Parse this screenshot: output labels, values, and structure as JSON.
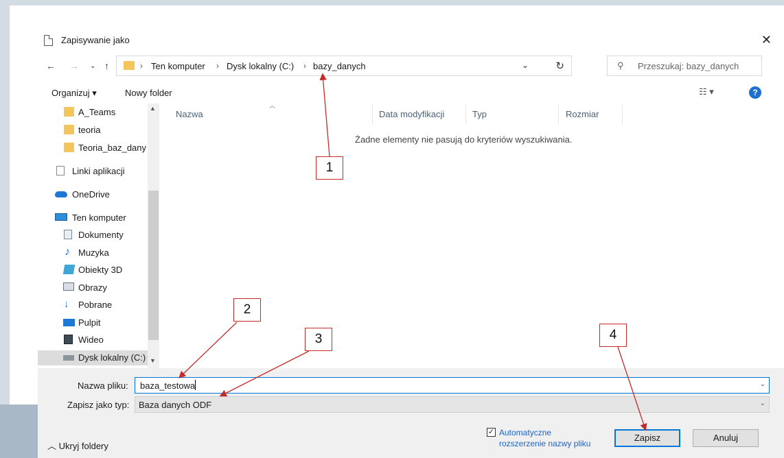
{
  "dialog": {
    "title": "Zapisywanie jako"
  },
  "address": {
    "crumbs": [
      "Ten komputer",
      "Dysk lokalny (C:)",
      "bazy_danych"
    ]
  },
  "search": {
    "placeholder": "Przeszukaj: bazy_danych"
  },
  "toolbar": {
    "organize_label": "Organizuj ▾",
    "new_folder_label": "Nowy folder"
  },
  "sidebar": {
    "items": [
      {
        "label": "A_Teams",
        "icon": "folder-icon"
      },
      {
        "label": "teoria",
        "icon": "folder-icon"
      },
      {
        "label": "Teoria_baz_dany",
        "icon": "folder-icon"
      },
      {
        "label": "Linki aplikacji",
        "icon": "page-icon"
      },
      {
        "label": "OneDrive",
        "icon": "cloud-icon"
      },
      {
        "label": "Ten komputer",
        "icon": "computer-icon"
      },
      {
        "label": "Dokumenty",
        "icon": "documents-icon"
      },
      {
        "label": "Muzyka",
        "icon": "music-icon"
      },
      {
        "label": "Obiekty 3D",
        "icon": "objects-3d-icon"
      },
      {
        "label": "Obrazy",
        "icon": "pictures-icon"
      },
      {
        "label": "Pobrane",
        "icon": "download-icon"
      },
      {
        "label": "Pulpit",
        "icon": "desktop-icon"
      },
      {
        "label": "Wideo",
        "icon": "video-icon"
      },
      {
        "label": "Dysk lokalny (C:)",
        "icon": "drive-icon"
      }
    ]
  },
  "file_list": {
    "columns": [
      "Nazwa",
      "Data modyfikacji",
      "Typ",
      "Rozmiar"
    ],
    "empty_message": "Żadne elementy nie pasują do kryteriów wyszukiwania."
  },
  "form": {
    "filename_label": "Nazwa pliku:",
    "filename_value": "baza_testowa",
    "type_label": "Zapisz jako typ:",
    "type_value": "Baza danych ODF",
    "hide_folders": "Ukryj foldery",
    "auto_ext_line1": "Automatyczne",
    "auto_ext_line2": "rozszerzenie nazwy pliku",
    "auto_ext_checked": true,
    "save_label": "Zapisz",
    "cancel_label": "Anuluj"
  },
  "annotations": {
    "labels": [
      "1",
      "2",
      "3",
      "4"
    ],
    "color": "#c52a2a"
  }
}
